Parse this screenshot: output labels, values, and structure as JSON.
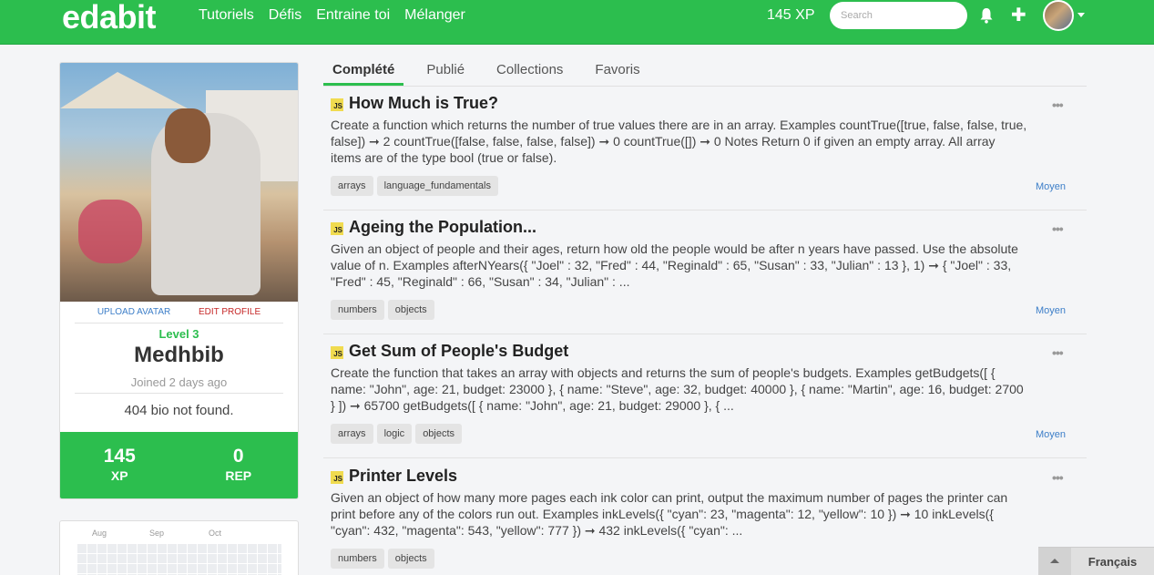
{
  "header": {
    "logo": "edabit",
    "nav": [
      "Tutoriels",
      "Défis",
      "Entraine toi",
      "Mélanger"
    ],
    "xp": "145 XP",
    "search_placeholder": "Search"
  },
  "profile": {
    "upload_avatar": "UPLOAD AVATAR",
    "edit_profile": "EDIT PROFILE",
    "level": "Level 3",
    "username": "Medhbib",
    "joined": "Joined 2 days ago",
    "bio": "404 bio not found.",
    "xp_value": "145",
    "xp_label": "XP",
    "rep_value": "0",
    "rep_label": "REP"
  },
  "activity": {
    "months": [
      "Aug",
      "Sep",
      "Oct"
    ]
  },
  "tabs": [
    "Complété",
    "Publié",
    "Collections",
    "Favoris"
  ],
  "challenges": [
    {
      "language": "JS",
      "title": "How Much is True?",
      "description": "Create a function which returns the number of true values there are in an array. Examples countTrue([true, false, false, true, false]) ➞ 2 countTrue([false, false, false, false]) ➞ 0 countTrue([]) ➞ 0 Notes Return 0 if given an empty array. All array items are of the type bool (true or false).",
      "tags": [
        "arrays",
        "language_fundamentals"
      ],
      "difficulty": "Moyen",
      "menu": "•••"
    },
    {
      "language": "JS",
      "title": "Ageing the Population...",
      "description": "Given an object of people and their ages, return how old the people would be after n years have passed. Use the absolute value of n. Examples afterNYears({ \"Joel\" : 32, \"Fred\" : 44, \"Reginald\" : 65, \"Susan\" : 33, \"Julian\" : 13 }, 1) ➞ { \"Joel\" : 33, \"Fred\" : 45, \"Reginald\" : 66, \"Susan\" : 34, \"Julian\" : ...",
      "tags": [
        "numbers",
        "objects"
      ],
      "difficulty": "Moyen",
      "menu": "•••"
    },
    {
      "language": "JS",
      "title": "Get Sum of People's Budget",
      "description": "Create the function that takes an array with objects and returns the sum of people's budgets. Examples getBudgets([ { name: \"John\", age: 21, budget: 23000 }, { name: \"Steve\", age: 32, budget: 40000 }, { name: \"Martin\", age: 16, budget: 2700 } ]) ➞ 65700 getBudgets([ { name: \"John\", age: 21, budget: 29000 }, { ...",
      "tags": [
        "arrays",
        "logic",
        "objects"
      ],
      "difficulty": "Moyen",
      "menu": "•••"
    },
    {
      "language": "JS",
      "title": "Printer Levels",
      "description": "Given an object of how many more pages each ink color can print, output the maximum number of pages the printer can print before any of the colors run out. Examples inkLevels({ \"cyan\": 23, \"magenta\": 12, \"yellow\": 10 }) ➞ 10 inkLevels({ \"cyan\": 432, \"magenta\": 543, \"yellow\": 777 }) ➞ 432 inkLevels({ \"cyan\": ...",
      "tags": [
        "numbers",
        "objects"
      ],
      "difficulty": "",
      "menu": "•••"
    }
  ],
  "language_selector": "Français",
  "colors": {
    "brand": "#2cbe4e",
    "link": "#3c7ec8",
    "danger": "#c62828"
  }
}
